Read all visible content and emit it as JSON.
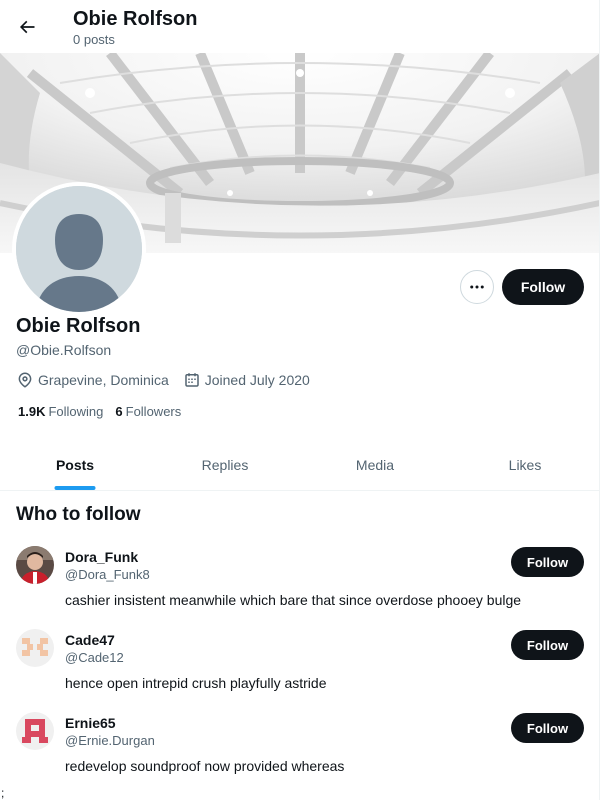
{
  "header": {
    "title": "Obie Rolfson",
    "post_count": "0 posts"
  },
  "profile": {
    "display_name": "Obie Rolfson",
    "handle": "@Obie.Rolfson",
    "location": "Grapevine, Dominica",
    "joined": "Joined July 2020",
    "following_count": "1.9K",
    "following_label": "Following",
    "followers_count": "6",
    "followers_label": "Followers",
    "follow_label": "Follow"
  },
  "tabs": [
    {
      "label": "Posts",
      "active": true
    },
    {
      "label": "Replies",
      "active": false
    },
    {
      "label": "Media",
      "active": false
    },
    {
      "label": "Likes",
      "active": false
    }
  ],
  "who_to_follow": {
    "title": "Who to follow",
    "items": [
      {
        "name": "Dora_Funk",
        "handle": "@Dora_Funk8",
        "bio": "cashier insistent meanwhile which bare that since overdose phooey bulge",
        "follow_label": "Follow"
      },
      {
        "name": "Cade47",
        "handle": "@Cade12",
        "bio": "hence open intrepid crush playfully astride",
        "follow_label": "Follow"
      },
      {
        "name": "Ernie65",
        "handle": "@Ernie.Durgan",
        "bio": "redevelop soundproof now provided whereas",
        "follow_label": "Follow"
      }
    ]
  },
  "stray_char": ";",
  "colors": {
    "accent": "#1d9bf0",
    "button_bg": "#0f1419",
    "muted_text": "#536471",
    "divider": "#eff3f4",
    "avatar_placeholder": "#cfd9de"
  },
  "icons": {
    "back": "arrow-left-icon",
    "more": "more-dots-icon",
    "location": "location-pin-icon",
    "calendar": "calendar-icon"
  }
}
